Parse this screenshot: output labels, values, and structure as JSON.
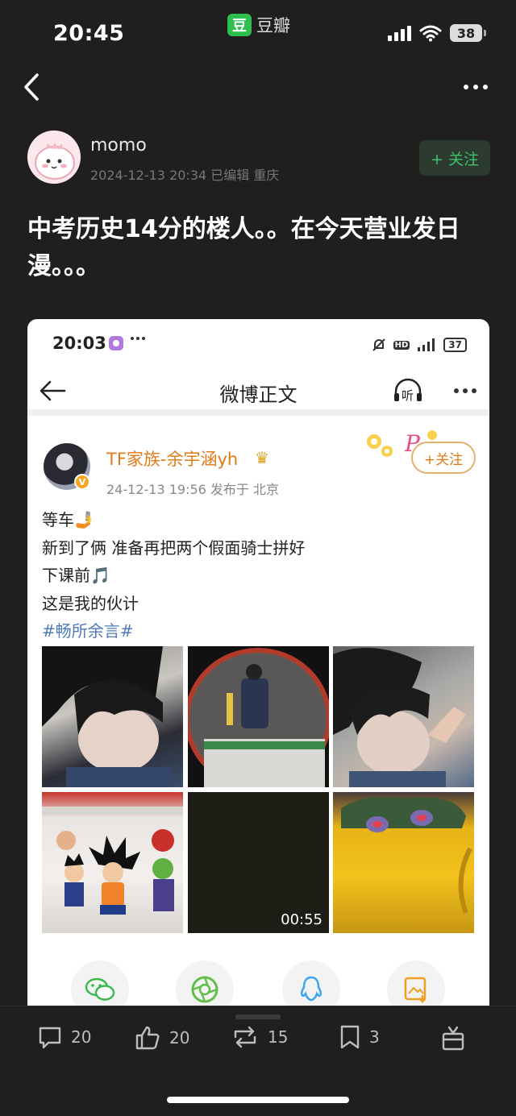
{
  "status_bar": {
    "time": "20:45",
    "app_badge": "豆",
    "app_name": "豆瓣",
    "battery": "38"
  },
  "author": {
    "name": "momo",
    "meta": "2024-12-13 20:34 已编辑 重庆",
    "follow_label": "+ 关注"
  },
  "post": {
    "title": "中考历史14分的楼人。。在今天营业发日漫。。。"
  },
  "embedded": {
    "status": {
      "time": "20:03",
      "battery": "37"
    },
    "nav": {
      "title": "微博正文",
      "listen_label": "听"
    },
    "weibo_user": {
      "name": "TF家族-余宇涵yh",
      "meta": "24-12-13 19:56  发布于 北京",
      "follow_label": "+关注",
      "verified_badge": "V"
    },
    "lines": [
      "等车🤳",
      "新到了俩 准备再把两个假面骑士拼好",
      "下课前🎵",
      "这是我的伙计"
    ],
    "hashtag": "#畅所余言#",
    "video_duration": "00:55"
  },
  "actions": {
    "comments": "20",
    "likes": "20",
    "reposts": "15",
    "collects": "3"
  },
  "colors": {
    "accent_green": "#3fc06a",
    "weibo_orange": "#e07b1a",
    "link_blue": "#4f7bb8"
  }
}
